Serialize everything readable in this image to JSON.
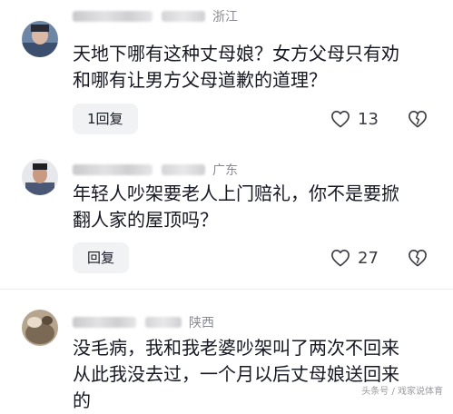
{
  "comments": [
    {
      "region": "浙江",
      "lines": [
        "天地下哪有这种丈母娘？女方父母只有劝",
        "和哪有让男方父母道歉的道理？"
      ],
      "reply_label": "1回复",
      "like_count": "13",
      "icons": {
        "like": "heart-outline-icon",
        "dislike": "broken-heart-icon"
      }
    },
    {
      "region": "广东",
      "lines": [
        "年轻人吵架要老人上门赔礼，你不是要掀",
        "翻人家的屋顶吗？"
      ],
      "reply_label": "回复",
      "like_count": "27",
      "icons": {
        "like": "heart-outline-icon",
        "dislike": "broken-heart-icon"
      }
    },
    {
      "region": "陕西",
      "lines": [
        "没毛病，我和我老婆吵架叫了两次不回来",
        "从此我没去过，一个月以后丈母娘送回来",
        "的"
      ]
    }
  ],
  "watermark": "头条号 / 戏家说体育"
}
